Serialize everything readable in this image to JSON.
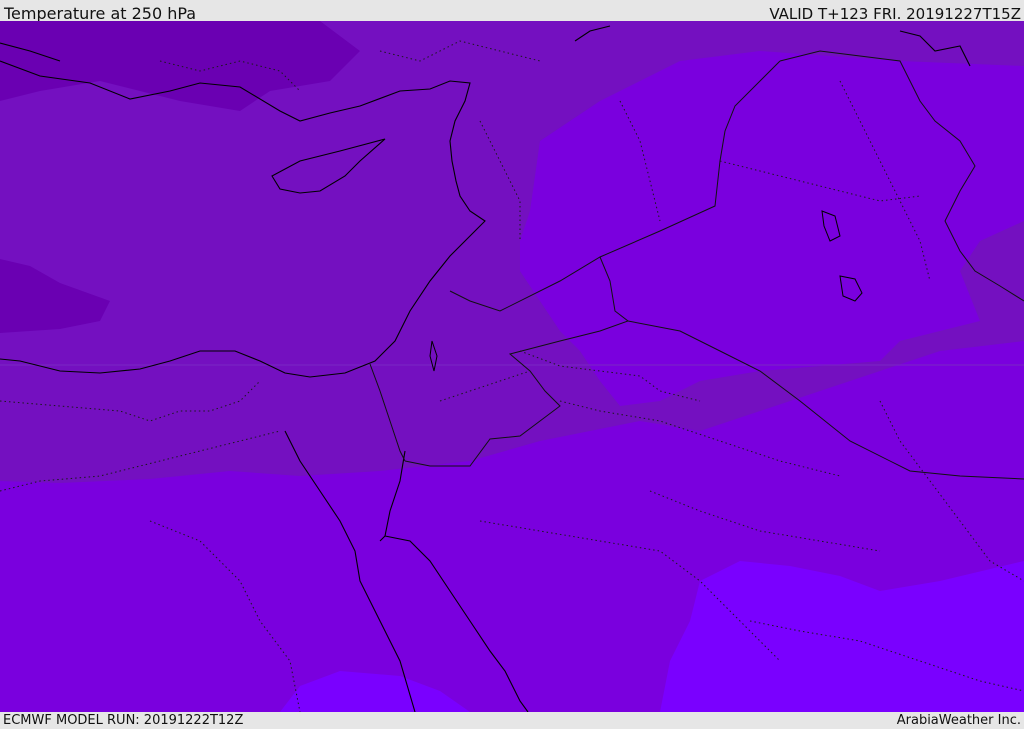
{
  "header": {
    "title": "Temperature at 250 hPa",
    "valid": "VALID T+123 FRI. 20191227T15Z"
  },
  "footer": {
    "model_run": "ECMWF MODEL RUN: 20191222T12Z",
    "brand": "ArabiaWeather Inc."
  },
  "colors": {
    "darkest": "#5e009c",
    "dark": "#6a00b2",
    "mid": "#7410c0",
    "bright": "#7a00de",
    "brighter": "#8200f0",
    "brightest": "#7a00ff",
    "coastline": "#000000",
    "border": "#222222"
  }
}
